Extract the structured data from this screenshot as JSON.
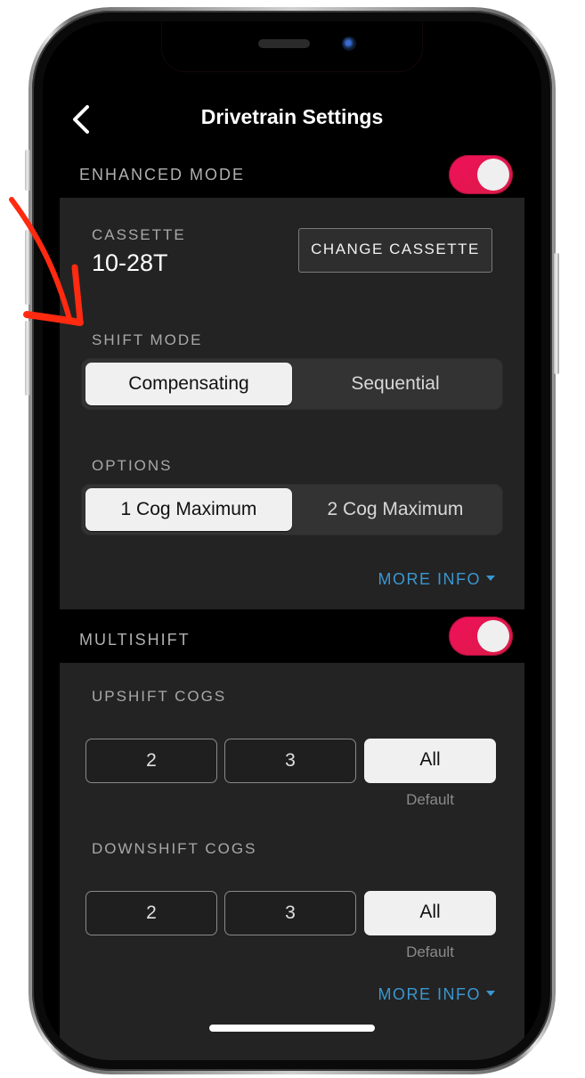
{
  "header": {
    "title": "Drivetrain Settings",
    "back_icon": "chevron-left-icon"
  },
  "enhanced_mode": {
    "label": "ENHANCED MODE",
    "enabled": true,
    "cassette": {
      "label": "CASSETTE",
      "value": "10-28T",
      "change_button": "CHANGE CASSETTE"
    },
    "shift_mode": {
      "label": "SHIFT MODE",
      "options": [
        "Compensating",
        "Sequential"
      ],
      "selected": "Compensating"
    },
    "options": {
      "label": "OPTIONS",
      "options": [
        "1 Cog Maximum",
        "2 Cog Maximum"
      ],
      "selected": "1 Cog Maximum"
    },
    "more_info": "MORE INFO"
  },
  "multishift": {
    "label": "MULTISHIFT",
    "enabled": true,
    "upshift": {
      "label": "UPSHIFT COGS",
      "options": [
        "2",
        "3",
        "All"
      ],
      "selected": "All",
      "default_label": "Default"
    },
    "downshift": {
      "label": "DOWNSHIFT COGS",
      "options": [
        "2",
        "3",
        "All"
      ],
      "selected": "All",
      "default_label": "Default"
    },
    "more_info": "MORE INFO"
  },
  "colors": {
    "accent_toggle": "#e8124f",
    "link": "#3a97d0",
    "annotation": "#ff2a10",
    "panel": "#232323",
    "background": "#000000"
  }
}
